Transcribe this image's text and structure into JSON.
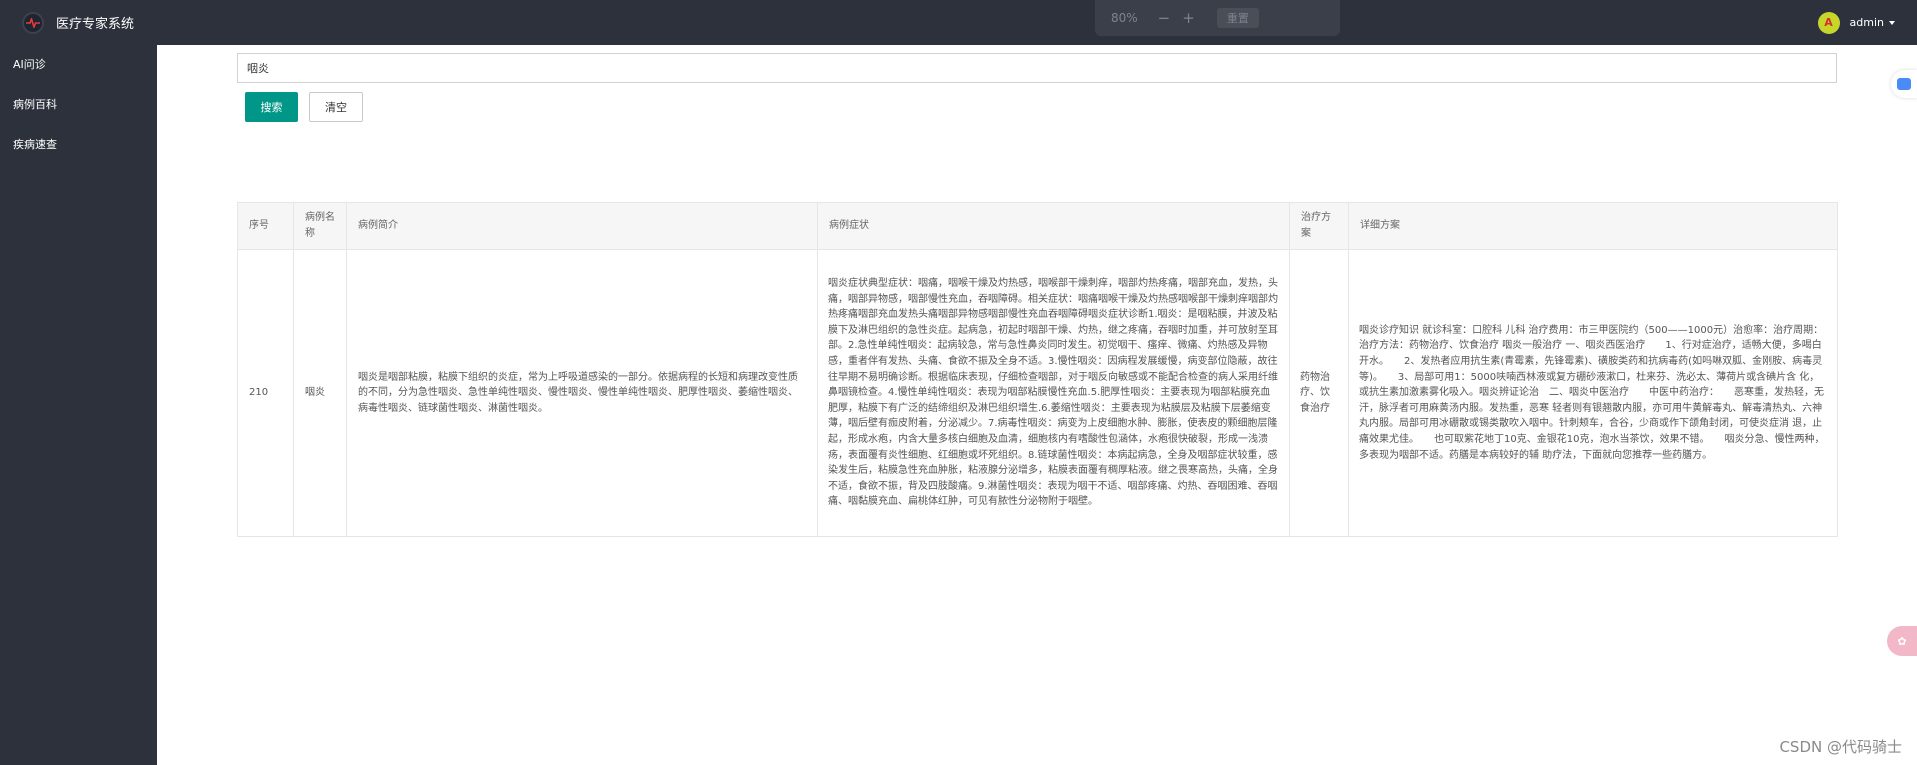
{
  "app": {
    "title": "医疗专家系统"
  },
  "zoom": {
    "level": "80%",
    "minus": "−",
    "plus": "+",
    "reset_label": "重置"
  },
  "user": {
    "name": "admin",
    "avatar_letter": "A"
  },
  "sidebar": {
    "items": [
      {
        "label": "AI问诊"
      },
      {
        "label": "病例百科"
      },
      {
        "label": "疾病速查"
      }
    ]
  },
  "search": {
    "value": "咽炎",
    "search_label": "搜索",
    "clear_label": "清空"
  },
  "table": {
    "columns": [
      "序号",
      "病例名称",
      "病例简介",
      "病例症状",
      "治疗方案",
      "详细方案"
    ],
    "rows": [
      {
        "id": "210",
        "name": "咽炎",
        "intro": "咽炎是咽部粘膜，粘膜下组织的炎症，常为上呼吸道感染的一部分。依据病程的长短和病理改变性质的不同，分为急性咽炎、急性单纯性咽炎、慢性咽炎、慢性单纯性咽炎、肥厚性咽炎、萎缩性咽炎、病毒性咽炎、链球菌性咽炎、淋菌性咽炎。",
        "symptoms": "咽炎症状典型症状：咽痛，咽喉干燥及灼热感，咽喉部干燥刺痒，咽部灼热疼痛，咽部充血，发热，头痛，咽部异物感，咽部慢性充血，吞咽障碍。相关症状：咽痛咽喉干燥及灼热感咽喉部干燥刺痒咽部灼热疼痛咽部充血发热头痛咽部异物感咽部慢性充血吞咽障碍咽炎症状诊断1.咽炎：是咽粘膜，并波及粘膜下及淋巴组织的急性炎症。起病急，初起时咽部干燥、灼热，继之疼痛，吞咽时加重，并可放射至耳部。2.急性单纯性咽炎：起病较急，常与急性鼻炎同时发生。初觉咽干、瘙痒、微痛、灼热感及异物感，重者伴有发热、头痛、食欲不振及全身不适。3.慢性咽炎：因病程发展缓慢，病变部位隐蔽，故往往早期不易明确诊断。根据临床表现，仔细检查咽部，对于咽反向敏感或不能配合检查的病人采用纤维鼻咽镜检查。4.慢性单纯性咽炎：表现为咽部粘膜慢性充血.5.肥厚性咽炎：主要表现为咽部粘膜充血肥厚，粘膜下有广泛的结缔组织及淋巴组织增生.6.萎缩性咽炎：主要表现为粘膜层及粘膜下层萎缩变薄，咽后壁有痂皮附着，分泌减少。7.病毒性咽炎：病变为上皮细胞水肿、膨胀，使表皮的颗细胞层隆起，形成水疱，内含大量多核白细胞及血清，细胞核内有嗜酸性包涵体，水疱很快破裂，形成一浅溃疡，表面覆有炎性细胞、红细胞或坏死组织。8.链球菌性咽炎：本病起病急，全身及咽部症状较重，感染发生后，粘膜急性充血肿胀，粘液腺分泌增多，粘膜表面覆有稠厚粘液。继之畏寒高热，头痛，全身不适，食欲不振，背及四肢酸痛。9.淋菌性咽炎：表现为咽干不适、咽部疼痛、灼热、吞咽困难、吞咽痛、咽黏膜充血、扁桃体红肿，可见有脓性分泌物附于咽壁。",
        "treatment": "药物治疗、饮食治疗",
        "detail": "咽炎诊疗知识 就诊科室：口腔科 儿科 治疗费用：市三甲医院约（500——1000元）治愈率：治疗周期：治疗方法：药物治疗、饮食治疗 咽炎一般治疗 一、咽炎西医治疗　　1、行对症治疗，适畅大便，多喝白开水。　　2、发热者应用抗生素(青霉素，先锋霉素)、磺胺类药和抗病毒药(如吗啉双胍、金刚胺、病毒灵等)。　　3、局部可用1：5000呋喃西林液或复方硼砂液漱口，杜来芬、洗必太、薄荷片或含碘片含 化，或抗生素加激素雾化吸入。咽炎辨证论治　二、咽炎中医治疗　　中医中药治疗：　　恶寒重，发热轻，无汗，脉浮者可用麻黄汤内服。发热重，恶寒 轻者则有银翘散内服，亦可用牛黄解毒丸、解毒清热丸、六神丸内服。局部可用冰硼散或锡类散吹入咽中。针刺颊车，合谷，少商或作下颌角封闭，可使炎症消 退，止痛效果尤佳。　　也可取紫花地丁10克、金银花10克，泡水当茶饮，效果不错。　　咽炎分急、慢性两种，多表现为咽部不适。药膳是本病较好的辅 助疗法，下面就向您推荐一些药膳方。"
      }
    ]
  },
  "float_buttons": {
    "assistant_label": "✿"
  },
  "watermark": "CSDN @代码骑士"
}
